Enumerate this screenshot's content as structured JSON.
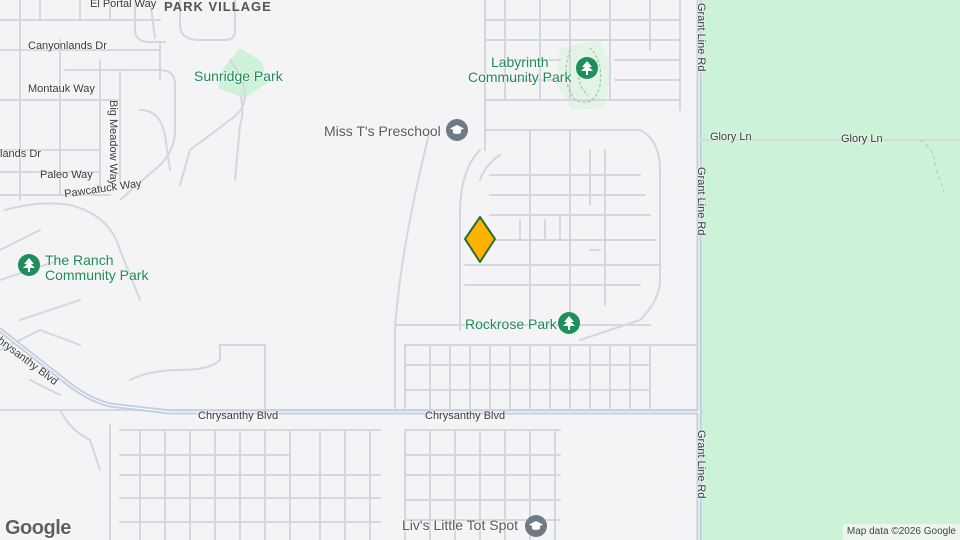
{
  "map": {
    "colors": {
      "land": "#f4f3f5",
      "road_minor": "#d5d7de",
      "road_major": "#c3cfe0",
      "park_green": "#ccf2d8",
      "park_label": "#1f8a55",
      "marker_fill": "#ffb300",
      "marker_stroke": "#2c6e2f"
    },
    "districts": {
      "sunridge_park_village": "PARK VILLAGE"
    },
    "streets": {
      "el_portal_way": "El Portal Way",
      "canyonlands_dr": "Canyonlands Dr",
      "montauk_way": "Montauk Way",
      "big_meadow_way": "Big Meadow Way",
      "lands_dr": "lands Dr",
      "paleo_way": "Paleo Way",
      "pawcatuck_way": "Pawcatuck Way",
      "chrysanthy_blvd_1": "Chrysanthy Blvd",
      "chrysanthy_blvd_2": "Chrysanthy Blvd",
      "chrysanthy_blvd_3": "Chrysanthy Blvd",
      "grant_line_rd_1": "Grant Line Rd",
      "grant_line_rd_2": "Grant Line Rd",
      "grant_line_rd_3": "Grant Line Rd",
      "glory_ln_1": "Glory Ln",
      "glory_ln_2": "Glory Ln"
    },
    "parks": {
      "sunridge_park": "Sunridge Park",
      "labyrinth_line1": "Labyrinth",
      "labyrinth_line2": "Community Park",
      "ranch_line1": "The Ranch",
      "ranch_line2": "Community Park",
      "rockrose_park": "Rockrose Park"
    },
    "pois": {
      "miss_ts_preschool": "Miss T's Preschool",
      "livs_little_tot_spot": "Liv's Little Tot Spot"
    },
    "icons": {
      "park_icon": "tree-icon",
      "school_icon": "graduation-cap-icon",
      "marker_icon": "location-marker-icon"
    },
    "logo": "Google",
    "attribution": "Map data ©2026 Google"
  }
}
